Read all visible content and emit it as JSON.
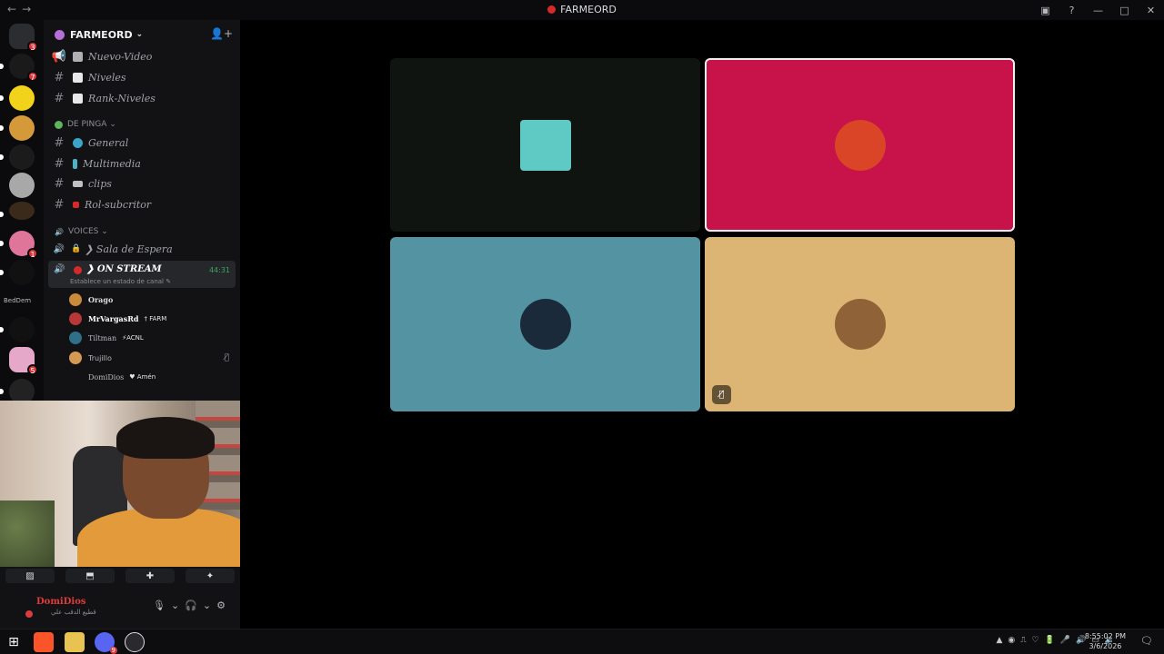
{
  "titlebar": {
    "back": "←",
    "forward": "→",
    "title": "FARMEORD",
    "icons": [
      "inbox-icon",
      "help-icon",
      "minimize-icon",
      "maximize-icon",
      "close-icon"
    ],
    "glyphs": {
      "inbox": "▣",
      "help": "?",
      "minimize": "—",
      "maximize": "□",
      "close": "✕"
    }
  },
  "servers": {
    "badges": {
      "first": "3",
      "second": "7",
      "third": "1",
      "fourth": "5"
    },
    "label_a": "BedDem",
    "label_b": "∞"
  },
  "guild": {
    "name": "FARMEORD",
    "chevron": "⌄",
    "invite_glyph": "👤+"
  },
  "channels_top": [
    {
      "name": "Nuevo-Video",
      "icon": "megaphone-icon",
      "hash": "📢",
      "emoji_color": "#b0b0b0"
    },
    {
      "name": "Niveles",
      "icon": "hash-icon",
      "hash": "#",
      "emoji_color": "#e8e8e8"
    },
    {
      "name": "Rank-Niveles",
      "icon": "hash-icon",
      "hash": "#",
      "emoji_color": "#e8e8e8"
    }
  ],
  "category_1": {
    "name": "DE PINGA",
    "chevron": "⌄",
    "icon_color": "#5fb35f"
  },
  "channels_mid": [
    {
      "name": "General",
      "hash": "#",
      "emoji_color": "#3ba4c9"
    },
    {
      "name": "Multimedia",
      "hash": "#",
      "emoji_color": "#4fb0c6"
    },
    {
      "name": "clips",
      "hash": "#",
      "emoji_color": "#c0c0c0"
    },
    {
      "name": "Rol-subcritor",
      "hash": "#",
      "emoji_color": "#d62a2a"
    }
  ],
  "category_2": {
    "name": "VOICES",
    "chevron": "⌄",
    "icon": "🔊"
  },
  "voice_waiting": {
    "name": "❯ Sala de Espera",
    "icon": "🔊",
    "lock": "🔒"
  },
  "voice_active": {
    "name": "❯ ON STREAM",
    "speaker": "🔊",
    "timer": "44:31",
    "status": "Establece un estado de canal ✎"
  },
  "voice_users": [
    {
      "name": "Orago",
      "tag": "",
      "avatar_color": "#c98a3a",
      "muted": false
    },
    {
      "name": "MrVargasRd",
      "tag": "† FARM",
      "avatar_color": "#b73838",
      "muted": false
    },
    {
      "name": "Tiltman",
      "tag": "⚡ACNL",
      "avatar_color": "#2f6f8a",
      "muted": false
    },
    {
      "name": "Trujillo",
      "tag": "",
      "avatar_color": "#d49a54",
      "muted": true,
      "mute_glyph": "🎙̸"
    },
    {
      "name": "DomiDios",
      "tag": "♥ Amén",
      "avatar_color": "#121214",
      "muted": false
    }
  ],
  "dock_actions": [
    {
      "name": "camera-off-button",
      "glyph": "▨"
    },
    {
      "name": "screen-share-button",
      "glyph": "⬒"
    },
    {
      "name": "activities-button",
      "glyph": "✚"
    },
    {
      "name": "soundboard-button",
      "glyph": "✦"
    }
  ],
  "userpanel": {
    "name": "DomiDios",
    "status": "قطيع الدقب علي",
    "mic": "🎙",
    "mic_chevron": "⌄",
    "headset": "🎧",
    "headset_chevron": "⌄",
    "settings": "⚙"
  },
  "stage_tiles": [
    {
      "id": "tile-top-left",
      "bg": "#101411",
      "avatar_color": "#5fc9c4",
      "selected": false,
      "muted": false
    },
    {
      "id": "tile-top-right",
      "bg": "#c8124a",
      "avatar_color": "#d94526",
      "selected": true,
      "muted": false
    },
    {
      "id": "tile-bottom-left",
      "bg": "#5493a1",
      "avatar_color": "#1b2a3a",
      "selected": false,
      "muted": false
    },
    {
      "id": "tile-bottom-right",
      "bg": "#dcb574",
      "avatar_color": "#8f6238",
      "selected": false,
      "muted": true,
      "mute_glyph": "🎙̸"
    }
  ],
  "taskbar": {
    "start": "⊞",
    "apps": [
      "brave-icon",
      "files-icon",
      "discord-icon",
      "obs-icon"
    ],
    "discord_badge": "9",
    "tray_glyphs": [
      "▲",
      "◉",
      "⎍",
      "♡",
      "🔋",
      "🎤",
      "🔊",
      "▭",
      "🔉"
    ],
    "time": "8:55:02 PM",
    "date": "3/6/2026",
    "notif": "🗨"
  }
}
